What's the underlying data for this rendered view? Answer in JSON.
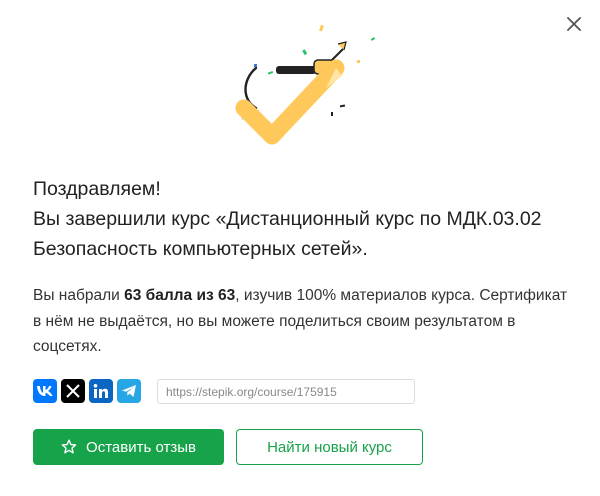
{
  "dialog": {
    "close_icon": "close-icon",
    "illustration": "celebration-checkmark-icon"
  },
  "heading": {
    "line1": "Поздравляем!",
    "line2": "Вы завершили курс «Дистанционный курс по МДК.03.02 Безопасность компьютерных сетей»."
  },
  "result": {
    "prefix": "Вы набрали ",
    "score": "63 балла из 63",
    "suffix": ", изучив 100% материалов курса.",
    "certificate_note": "Сертификат в нём не выдаётся, но вы можете поделиться своим результатом в соцсетях."
  },
  "share": {
    "networks": [
      "vk-icon",
      "x-icon",
      "linkedin-icon",
      "telegram-icon"
    ],
    "link_value": "https://stepik.org/course/175915"
  },
  "actions": {
    "review_label": "Оставить отзыв",
    "find_label": "Найти новый курс"
  },
  "colors": {
    "primary": "#17a34a",
    "accent": "#ffc85a"
  }
}
